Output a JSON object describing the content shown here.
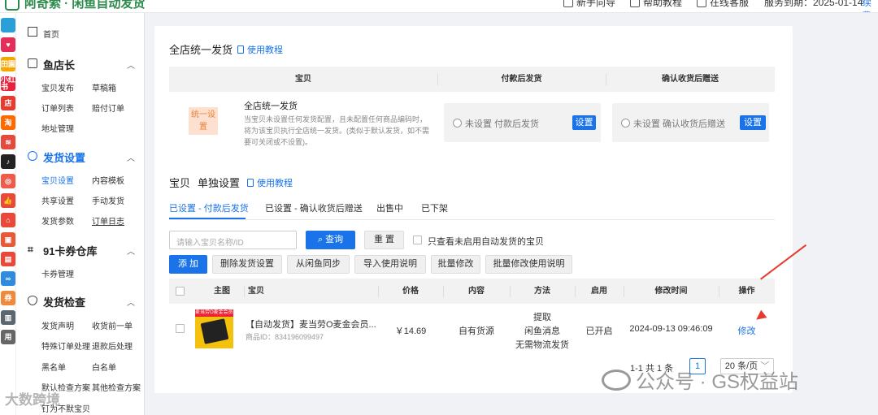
{
  "header": {
    "brand": "阿奇索 · 闲鱼自动发货",
    "nav": [
      "新手向导",
      "帮助教程",
      "在线客服"
    ],
    "service_expiry": "服务到期：2025-01-14",
    "renew": "续费"
  },
  "apps": [
    {
      "name": "grid-app-icon",
      "label": "",
      "color": "#2aa0d8"
    },
    {
      "name": "heart-app-icon",
      "label": "♥",
      "color": "#e52d5a"
    },
    {
      "name": "field-app-icon",
      "label": "田園",
      "color": "#f5a700"
    },
    {
      "name": "xiaohongshu-app-icon",
      "label": "小红书",
      "color": "#e8223a"
    },
    {
      "name": "store-app-icon",
      "label": "店",
      "color": "#e63b2e"
    },
    {
      "name": "taobao-app-icon",
      "label": "淘",
      "color": "#ff6a00"
    },
    {
      "name": "wifi-app-icon",
      "label": "≋",
      "color": "#e54a3e"
    },
    {
      "name": "tiktok-app-icon",
      "label": "♪",
      "color": "#222222"
    },
    {
      "name": "people-app-icon",
      "label": "◎",
      "color": "#ef5a4a"
    },
    {
      "name": "thumb-app-icon",
      "label": "👍",
      "color": "#e8493a"
    },
    {
      "name": "house-app-icon",
      "label": "⌂",
      "color": "#e8493a"
    },
    {
      "name": "box-app-icon",
      "label": "▣",
      "color": "#e8593a"
    },
    {
      "name": "card-app-icon",
      "label": "▤",
      "color": "#e8493a"
    },
    {
      "name": "link-app-icon",
      "label": "∞",
      "color": "#2e8be0"
    },
    {
      "name": "coupon-app-icon",
      "label": "券",
      "color": "#f08a3a"
    },
    {
      "name": "bag-app-icon",
      "label": "▥",
      "color": "#5a6670"
    },
    {
      "name": "gray-app-icon",
      "label": "用",
      "color": "#666"
    }
  ],
  "sidebar": {
    "home": "首页",
    "sections": [
      {
        "title": "鱼店长",
        "items": [
          "宝贝发布",
          "草稿箱",
          "订单列表",
          "赔付订单",
          "地址管理"
        ]
      },
      {
        "title": "发货设置",
        "items": [
          "宝贝设置",
          "内容模板",
          "共享设置",
          "手动发货",
          "发货参数",
          "订单日志"
        ]
      },
      {
        "title": "91卡券仓库",
        "items": [
          "卡券管理"
        ]
      },
      {
        "title": "发货检查",
        "items": [
          "发货声明",
          "收货前一单",
          "特殊订单处理",
          "退款后处理",
          "黑名单",
          "白名单",
          "默认检查方案",
          "其他检查方案",
          "钉为不默宝贝"
        ]
      }
    ],
    "watermark": "大数跨境"
  },
  "global": {
    "title": "全店统一发货",
    "tutorial": "使用教程",
    "columns": [
      "宝贝",
      "付款后发货",
      "确认收货后赠送"
    ],
    "tag": "统一设置",
    "row_title": "全店统一发货",
    "row_desc": "当宝贝未设置任何发货配置，且未配置任何商品编码时，将为该宝贝执行全店统一发货。(类似于默认发货，如不需要可关闭或不设置)。",
    "pay_status": "未设置 付款后发货",
    "confirm_status": "未设置 确认收货后赠送",
    "set_button": "设置"
  },
  "single": {
    "title_a": "宝贝",
    "title_b": "单独设置",
    "tutorial": "使用教程",
    "tabs": [
      "已设置 - 付款后发货",
      "已设置 - 确认收货后赠送",
      "出售中",
      "已下架"
    ],
    "search_placeholder": "请输入宝贝名称/ID",
    "query": "查询",
    "reset": "重 置",
    "only_unset": "只查看未启用自动发货的宝贝",
    "actions": [
      "添 加",
      "删除发货设置",
      "从闲鱼同步",
      "导入使用说明",
      "批量修改",
      "批量修改使用说明"
    ],
    "columns": [
      "主图",
      "宝贝",
      "价格",
      "内容",
      "方法",
      "启用",
      "修改时间",
      "操作"
    ],
    "rows": [
      {
        "thumb_text": "麦当劳O麦金会员卡",
        "title": "【自动发货】麦当劳O麦金会员...",
        "item_id": "商品ID：834196099497",
        "price": "￥14.69",
        "content": "自有货源",
        "methods": [
          "提取",
          "闲鱼消息",
          "无需物流发货"
        ],
        "enabled": "已开启",
        "modified": "2024-09-13 09:46:09",
        "action": "修改"
      }
    ],
    "pager": {
      "summary": "1-1 共 1 条",
      "page": "1",
      "page_size": "20 条/页"
    }
  },
  "watermark_right": "公众号 · GS权益站"
}
